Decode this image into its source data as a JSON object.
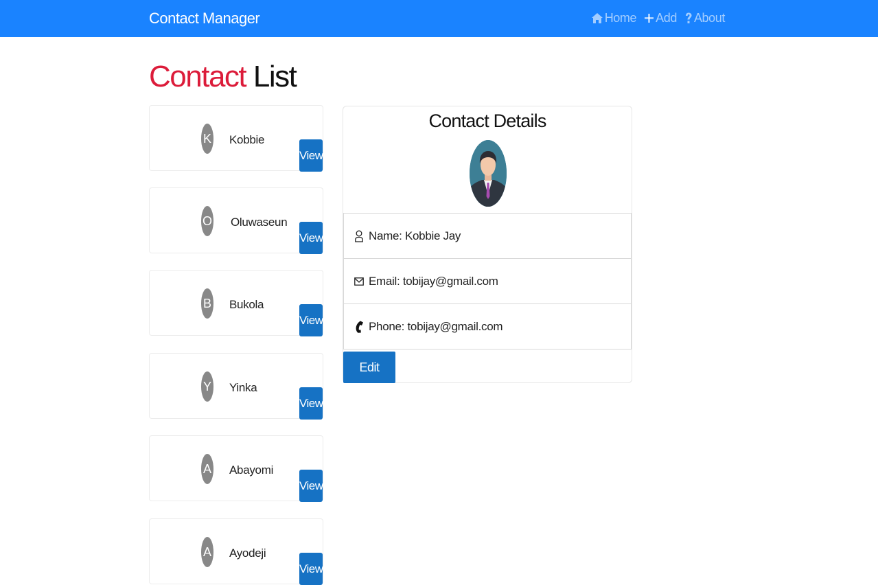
{
  "navbar": {
    "brand": "Contact Manager",
    "links": [
      {
        "icon": "home-icon",
        "label": "Home"
      },
      {
        "icon": "plus-icon",
        "label": "Add"
      },
      {
        "icon": "question-icon",
        "label": "About"
      }
    ]
  },
  "page": {
    "title_accent": "Contact",
    "title_rest": "List"
  },
  "contacts": [
    {
      "initial": "K",
      "name": "Kobbie",
      "view_label": "View"
    },
    {
      "initial": "O",
      "name": "Oluwaseun",
      "view_label": "View"
    },
    {
      "initial": "B",
      "name": "Bukola",
      "view_label": "View"
    },
    {
      "initial": "Y",
      "name": "Yinka",
      "view_label": "View"
    },
    {
      "initial": "A",
      "name": "Abayomi",
      "view_label": "View"
    },
    {
      "initial": "A",
      "name": "Ayodeji",
      "view_label": "View"
    }
  ],
  "details": {
    "title": "Contact Details",
    "photo_icon": "person-avatar-icon",
    "name": "Name: Kobbie Jay",
    "email": "Email: tobijay@gmail.com",
    "phone": "Phone: tobijay@gmail.com",
    "edit_label": "Edit"
  },
  "colors": {
    "navbar": "#1a83ff",
    "accent_red": "#dc1c3a",
    "button_blue": "#1672c4",
    "avatar_gray": "#888888"
  }
}
